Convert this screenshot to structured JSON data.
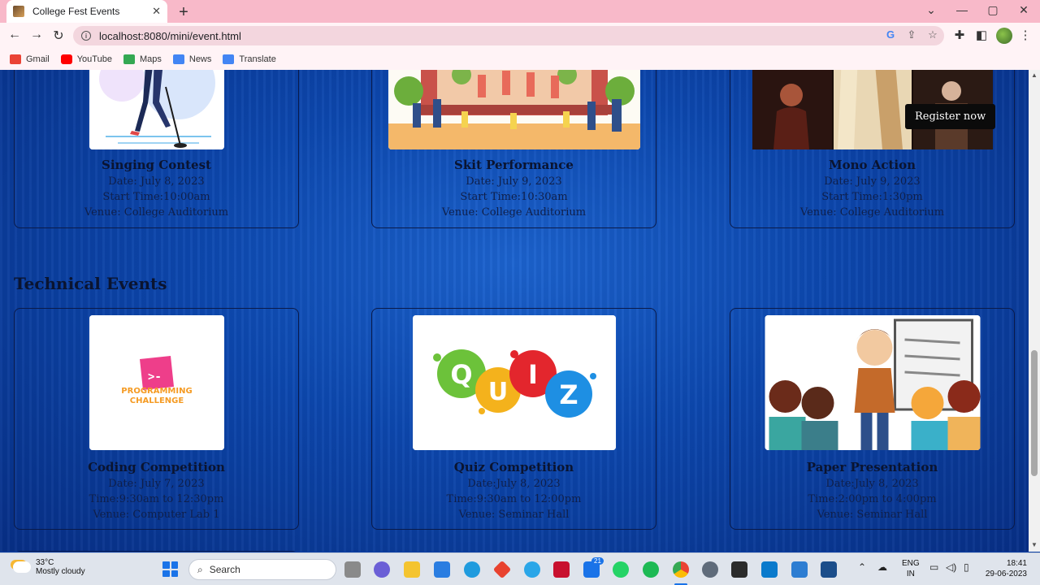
{
  "browser": {
    "tab_title": "College Fest Events",
    "tab_close": "✕",
    "new_tab": "+",
    "url": "localhost:8080/mini/event.html",
    "bookmarks": [
      {
        "label": "Gmail",
        "color": "#ea4335"
      },
      {
        "label": "YouTube",
        "color": "#ff0000"
      },
      {
        "label": "Maps",
        "color": "#34a853"
      },
      {
        "label": "News",
        "color": "#4285f4"
      },
      {
        "label": "Translate",
        "color": "#4285f4"
      }
    ]
  },
  "page": {
    "cultural_events": [
      {
        "title": "Singing Contest",
        "date": "Date: July 8, 2023",
        "time": "Start Time:10:00am",
        "venue": "Venue: College Auditorium"
      },
      {
        "title": "Skit Performance",
        "date": "Date: July 9, 2023",
        "time": "Start Time:10:30am",
        "venue": "Venue: College Auditorium"
      },
      {
        "title": "Mono Action",
        "date": "Date: July 9, 2023",
        "time": "Start Time:1:30pm",
        "venue": "Venue: College Auditorium"
      }
    ],
    "register_label": "Register now",
    "technical_section_title": "Technical Events",
    "technical_events": [
      {
        "title": "Coding Competition",
        "date": "Date: July 7, 2023",
        "time": "Time:9:30am to 12:30pm",
        "venue": "Venue: Computer Lab 1",
        "image_text": "PROGRAMMING CHALLENGE"
      },
      {
        "title": "Quiz Competition",
        "date": "Date:July 8, 2023",
        "time": "Time:9:30am to 12:00pm",
        "venue": "Venue: Seminar Hall",
        "image_text": "QUIZ"
      },
      {
        "title": "Paper Presentation",
        "date": "Date:July 8, 2023",
        "time": "Time:2:00pm to 4:00pm",
        "venue": "Venue: Seminar Hall"
      }
    ]
  },
  "taskbar": {
    "temperature": "33°C",
    "weather": "Mostly cloudy",
    "search_placeholder": "Search",
    "badge_count": "21",
    "lang_top": "ENG",
    "lang_bottom": "IN",
    "time": "18:41",
    "date": "29-06-2023"
  }
}
